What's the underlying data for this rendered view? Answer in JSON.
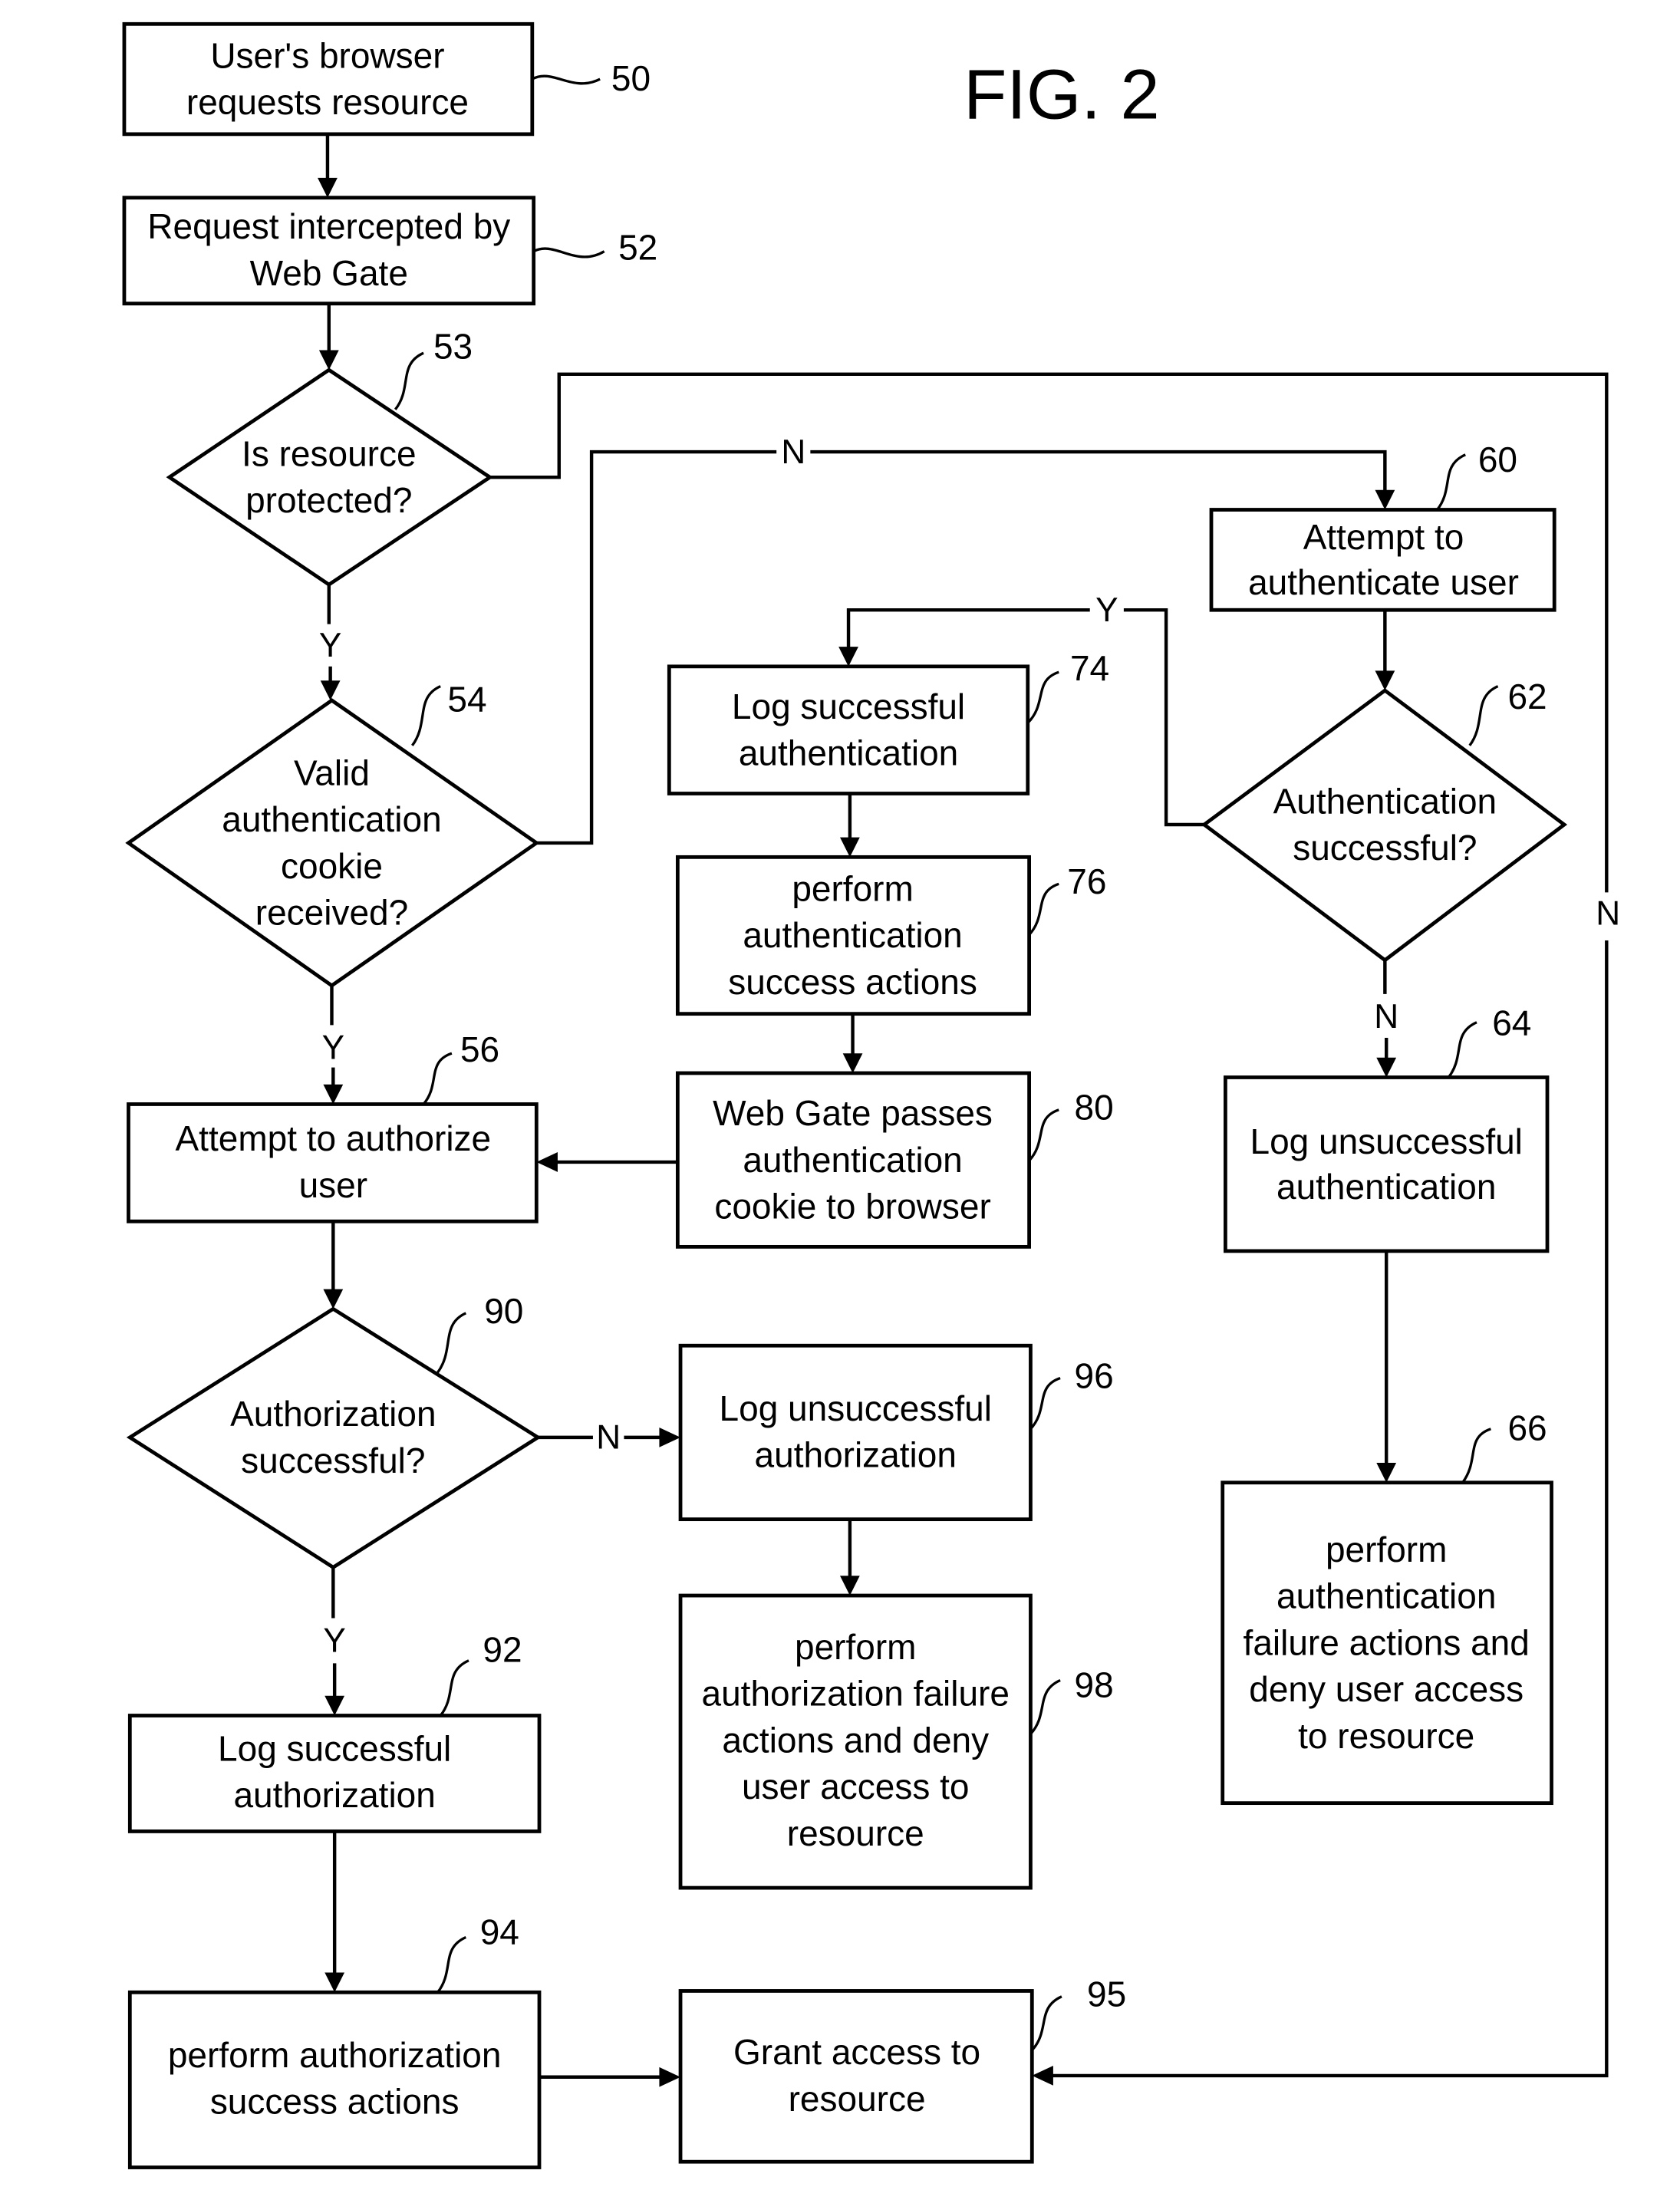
{
  "figure": {
    "title": "FIG. 2"
  },
  "nodes": {
    "n50": {
      "ref": "50",
      "lines": [
        "User's browser",
        "requests resource"
      ]
    },
    "n52": {
      "ref": "52",
      "lines": [
        "Request intercepted by",
        "Web Gate"
      ]
    },
    "n53": {
      "ref": "53",
      "lines": [
        "Is resource",
        "protected?"
      ]
    },
    "n54": {
      "ref": "54",
      "lines": [
        "Valid",
        "authentication",
        "cookie",
        "received?"
      ]
    },
    "n56": {
      "ref": "56",
      "lines": [
        "Attempt to authorize",
        "user"
      ]
    },
    "n60": {
      "ref": "60",
      "lines": [
        "Attempt to",
        "authenticate user"
      ]
    },
    "n62": {
      "ref": "62",
      "lines": [
        "Authentication",
        "successful?"
      ]
    },
    "n64": {
      "ref": "64",
      "lines": [
        "Log unsuccessful",
        "authentication"
      ]
    },
    "n66": {
      "ref": "66",
      "lines": [
        "perform",
        "authentication",
        "failure actions and",
        "deny user access",
        "to resource"
      ]
    },
    "n74": {
      "ref": "74",
      "lines": [
        "Log successful",
        "authentication"
      ]
    },
    "n76": {
      "ref": "76",
      "lines": [
        "perform",
        "authentication",
        "success actions"
      ]
    },
    "n80": {
      "ref": "80",
      "lines": [
        "Web Gate passes",
        "authentication",
        "cookie to browser"
      ]
    },
    "n90": {
      "ref": "90",
      "lines": [
        "Authorization",
        "successful?"
      ]
    },
    "n92": {
      "ref": "92",
      "lines": [
        "Log successful",
        "authorization"
      ]
    },
    "n94": {
      "ref": "94",
      "lines": [
        "perform authorization",
        "success actions"
      ]
    },
    "n95": {
      "ref": "95",
      "lines": [
        "Grant access to",
        "resource"
      ]
    },
    "n96": {
      "ref": "96",
      "lines": [
        "Log unsuccessful",
        "authorization"
      ]
    },
    "n98": {
      "ref": "98",
      "lines": [
        "perform",
        "authorization failure",
        "actions and deny",
        "user access  to",
        "resource"
      ]
    }
  },
  "edge_labels": {
    "e53_yes": "Y",
    "e53_no": "N",
    "e54_yes": "Y",
    "e54_no": "N",
    "e62_yes": "Y",
    "e62_no": "N",
    "e90_yes": "Y",
    "e90_no": "N"
  }
}
